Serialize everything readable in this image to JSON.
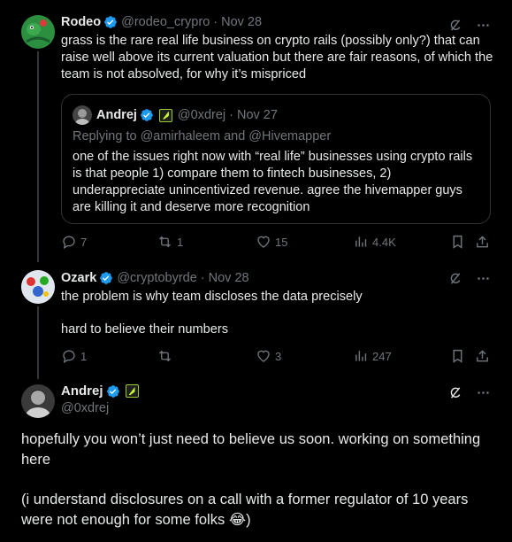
{
  "tweet1": {
    "name": "Rodeo",
    "handle": "@rodeo_crypro",
    "date": "Nov 28",
    "text": "grass is the rare real life business on crypto rails (possibly only?) that can raise well above its current valuation but there are fair reasons, of which the team is not absolved, for why it’s mispriced",
    "quote": {
      "name": "Andrej",
      "handle": "@0xdrej",
      "date": "Nov 27",
      "replying": "Replying to @amirhaleem and @Hivemapper",
      "text": "one of the issues right now with “real life” businesses using crypto rails is that people 1) compare them to fintech businesses, 2) underappreciate unincentivized revenue. agree the hivemapper guys are killing it and deserve more recognition"
    },
    "stats": {
      "replies": "7",
      "reposts": "1",
      "likes": "15",
      "views": "4.4K"
    }
  },
  "tweet2": {
    "name": "Ozark",
    "handle": "@cryptobyrde",
    "date": "Nov 28",
    "line1": "the problem is why team discloses the data precisely",
    "line2": "hard to believe their numbers",
    "stats": {
      "replies": "1",
      "reposts": "",
      "likes": "3",
      "views": "247"
    }
  },
  "tweet3": {
    "name": "Andrej",
    "handle": "@0xdrej",
    "para1": "hopefully you won’t just need to believe us soon. working on something here",
    "para2": "(i understand disclosures on a call with a former regulator of 10 years were not enough for some folks 😂)"
  },
  "colors": {
    "accent": "#1d9bf0",
    "muted": "#71767b",
    "text": "#e7e9ea",
    "border": "#2f3336"
  },
  "icons": [
    "verified-badge-icon",
    "grok-icon",
    "more-icon",
    "reply-icon",
    "repost-icon",
    "like-icon",
    "views-icon",
    "bookmark-icon",
    "share-icon",
    "affiliate-badge-icon"
  ]
}
